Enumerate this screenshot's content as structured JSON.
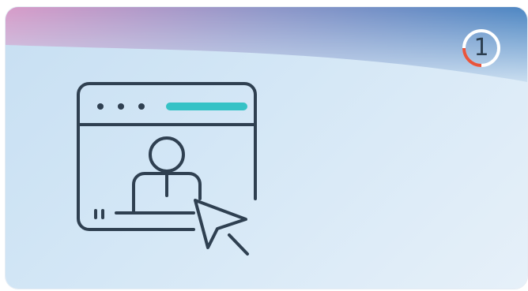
{
  "card": {
    "step_number": "1",
    "progress_fraction": 0.25
  },
  "icon": {
    "name": "online-user-click-icon"
  },
  "colors": {
    "stroke": "#2f4051",
    "accent_bar": "#35c2c6",
    "progress_arc": "#e8553c",
    "ring": "#ffffff"
  }
}
